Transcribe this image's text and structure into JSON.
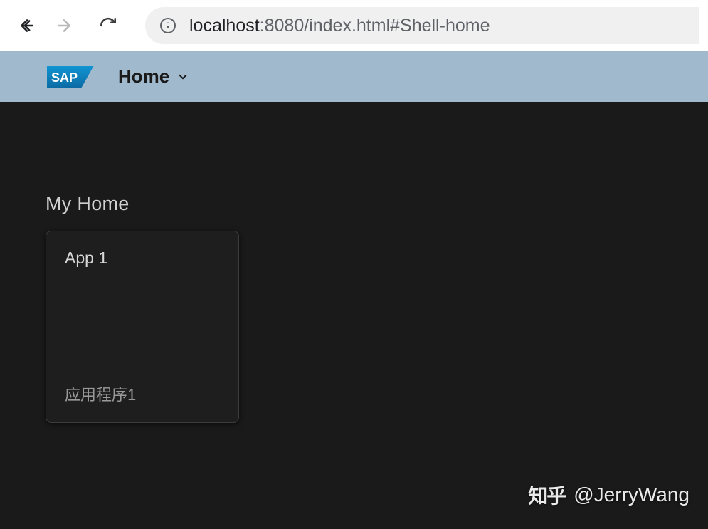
{
  "browser": {
    "url_host": "localhost",
    "url_rest": ":8080/index.html#Shell-home"
  },
  "shell": {
    "logo_text": "SAP",
    "nav_label": "Home"
  },
  "content": {
    "group_title": "My Home",
    "tiles": [
      {
        "title": "App 1",
        "subtitle": "应用程序1"
      }
    ]
  },
  "watermark": {
    "site": "知乎",
    "handle": "@JerryWang"
  }
}
